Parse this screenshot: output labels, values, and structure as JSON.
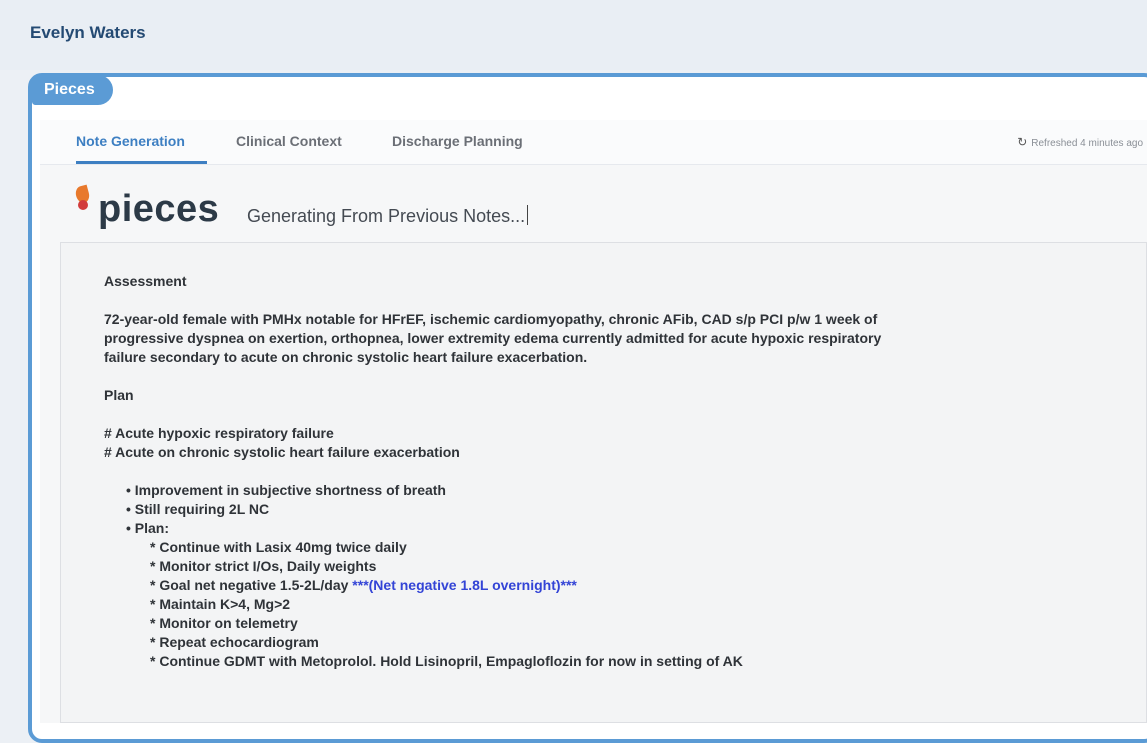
{
  "header": {
    "patient_name": "Evelyn Waters"
  },
  "panel": {
    "title": "Pieces"
  },
  "tabs": [
    {
      "label": "Note Generation",
      "active": true
    },
    {
      "label": "Clinical Context",
      "active": false
    },
    {
      "label": "Discharge Planning",
      "active": false
    }
  ],
  "refresh": {
    "text": "Refreshed 4 minutes ago",
    "icon": "refresh-icon"
  },
  "logo": {
    "text": "pieces"
  },
  "generation": {
    "status": "Generating From Previous Notes..."
  },
  "note": {
    "assessment_heading": "Assessment",
    "assessment_lines": [
      "72-year-old female with PMHx notable for HFrEF, ischemic cardiomyopathy, chronic AFib, CAD s/p PCI p/w 1 week of",
      "progressive dyspnea on exertion, orthopnea, lower extremity edema currently admitted for acute hypoxic respiratory",
      "failure secondary to acute on chronic systolic heart failure exacerbation."
    ],
    "plan_heading": "Plan",
    "problems": [
      "# Acute hypoxic respiratory failure",
      "# Acute on chronic systolic heart failure exacerbation"
    ],
    "bullets": [
      "• Improvement in subjective shortness of breath",
      "• Still requiring 2L NC",
      "• Plan:"
    ],
    "plan_items": [
      "* Continue with Lasix 40mg twice daily",
      "* Monitor strict I/Os, Daily weights",
      "* Goal net negative 1.5-2L/day",
      "* Maintain K>4, Mg>2",
      "* Monitor on telemetry",
      "* Repeat echocardiogram",
      "* Continue GDMT with Metoprolol. Hold Lisinopril, Empagloflozin for now in setting of AK"
    ],
    "highlight": "***(Net negative 1.8L overnight)***"
  },
  "colors": {
    "accent": "#5b9bd5",
    "active_tab": "#3d7fc2",
    "highlight": "#3344d6",
    "logo_orange": "#e8792c",
    "logo_red": "#d23c3c"
  }
}
